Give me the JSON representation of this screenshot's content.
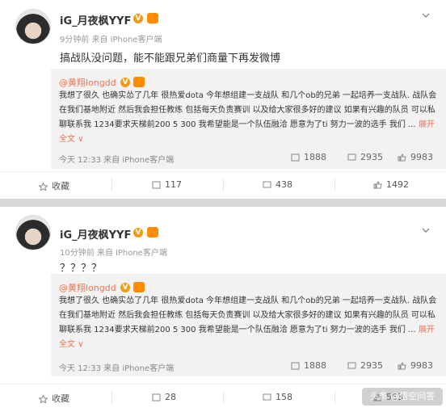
{
  "posts": [
    {
      "author": "iG_月夜枫YYF",
      "meta": "9分钟前 来自 iPhone客户端",
      "text": "搞战队没问题，能不能跟兄弟们商量下再发微博",
      "repost": {
        "author": "@黄翔longdd",
        "text": "我想了很久 也确实怂了几年 很热爱dota 今年想组建一支战队 和几个ob的兄弟 一起培养一支战队. 战队会在我们基地附近 然后我会担任教练 包括每天负责赛训 以及给大家很多好的建议 如果有兴趣的队员 可以私聊联系我 1234要求天梯前200 5 300 我希望能是一个队伍融洽 愿意为了ti 努力一波的选手 我们 ...",
        "expand": "展开全文 ∨",
        "time": "今天 12:33 来自 iPhone客户端",
        "reposts": "1888",
        "comments": "2935",
        "likes": "9983"
      },
      "actions": {
        "favorite": "收藏",
        "repost": "117",
        "comment": "438",
        "like": "1492"
      }
    },
    {
      "author": "iG_月夜枫YYF",
      "meta": "10分钟前 来自 iPhone客户端",
      "text": "？？？？",
      "repost": {
        "author": "@黄翔longdd",
        "text": "我想了很久 也确实怂了几年 很热爱dota 今年想组建一支战队 和几个ob的兄弟 一起培养一支战队. 战队会在我们基地附近 然后我会担任教练 包括每天负责赛训 以及给大家很多好的建议 如果有兴趣的队员 可以私聊联系我 1234要求天梯前200 5 300 我希望能是一个队伍融洽 愿意为了ti 努力一波的选手 我们 ...",
        "expand": "展开全文 ∨",
        "time": "今天 12:33 来自 iPhone客户端",
        "reposts": "1888",
        "comments": "2935",
        "likes": "9983"
      },
      "actions": {
        "favorite": "收藏",
        "repost": "28",
        "comment": "158",
        "like": "553"
      }
    }
  ],
  "watermark": "头条 @悟空问答",
  "colors": {
    "link": "#eb7350",
    "badge": "#f39c12",
    "background": "#d8d8d8"
  },
  "icons": [
    "verified-badge-icon",
    "medal-icon",
    "chevron-down-icon",
    "repost-icon",
    "comment-icon",
    "like-icon",
    "star-icon"
  ]
}
